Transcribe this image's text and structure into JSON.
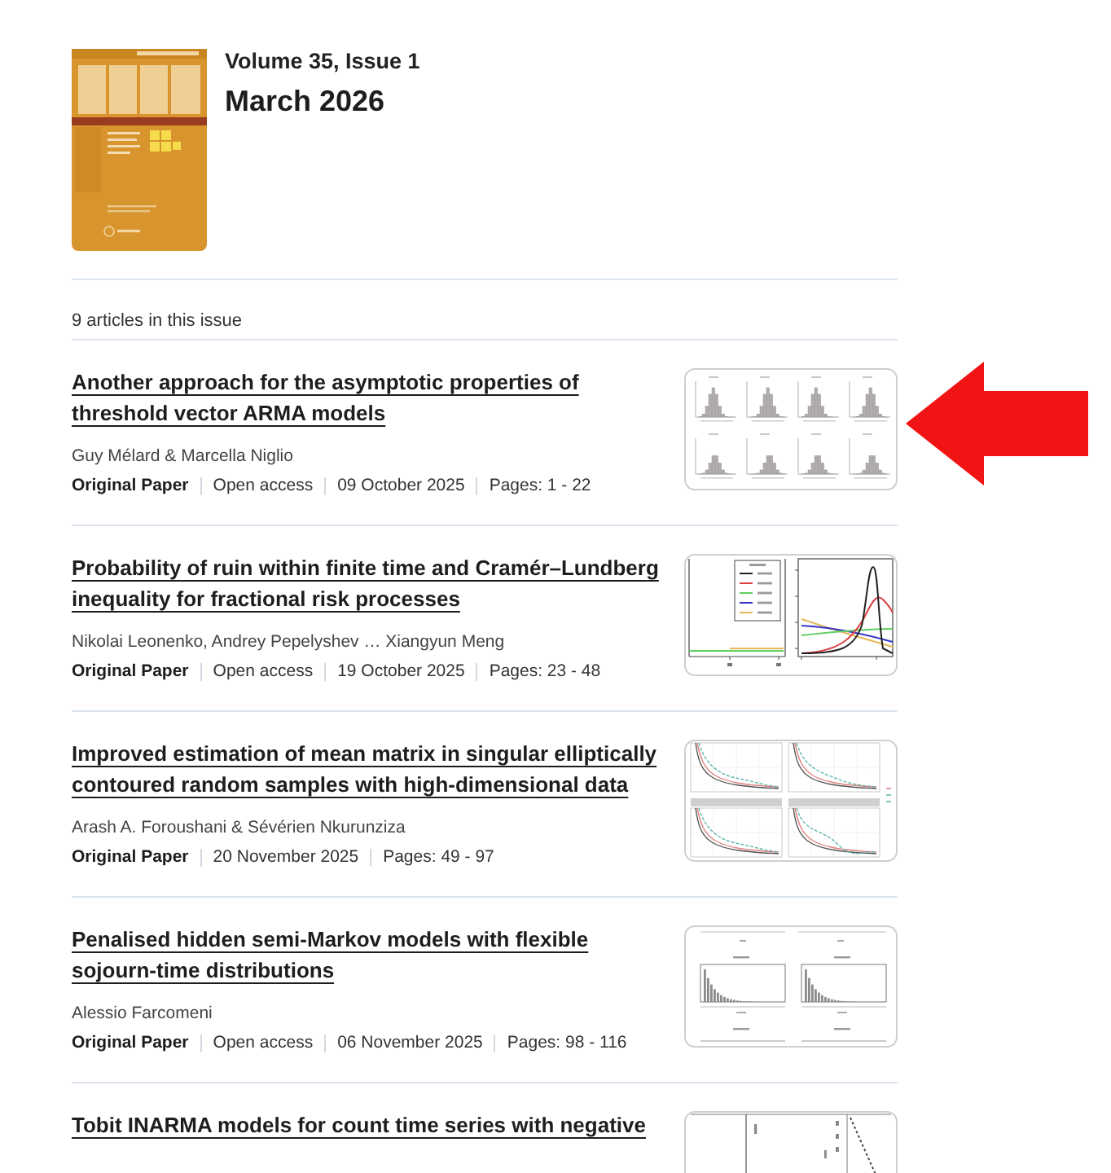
{
  "issue": {
    "volume": "Volume 35, Issue 1",
    "date": "March 2026"
  },
  "article_count": "9 articles in this issue",
  "articles": [
    {
      "title": "Another approach for the asymptotic properties of threshold vector ARMA models",
      "authors": "Guy Mélard & Marcella Niglio",
      "type": "Original Paper",
      "access": "Open access",
      "date": "09 October 2025",
      "pages": "Pages: 1 - 22",
      "thumbnail": {
        "kind": "histogram-grid"
      }
    },
    {
      "title": "Probability of ruin within finite time and Cramér–Lundberg inequality for fractional risk processes",
      "authors": "Nikolai Leonenko, Andrey Pepelyshev … Xiangyun Meng",
      "type": "Original Paper",
      "access": "Open access",
      "date": "19 October 2025",
      "pages": "Pages: 23 - 48",
      "thumbnail": {
        "kind": "line-chart"
      }
    },
    {
      "title": "Improved estimation of mean matrix in singular elliptically contoured random samples with high-dimensional data",
      "authors": "Arash A. Foroushani & Sévérien Nkurunziza",
      "type": "Original Paper",
      "date": "20 November 2025",
      "pages": "Pages: 49 - 97",
      "thumbnail": {
        "kind": "decay-curves"
      }
    },
    {
      "title": "Penalised hidden semi-Markov models with flexible sojourn-time distributions",
      "authors": "Alessio Farcomeni",
      "type": "Original Paper",
      "access": "Open access",
      "date": "06 November 2025",
      "pages": "Pages: 98 - 116",
      "thumbnail": {
        "kind": "decay-histogram"
      }
    },
    {
      "title": "Tobit INARMA models for count time series with negative",
      "thumbnail": {
        "kind": "line-plot"
      }
    }
  ]
}
